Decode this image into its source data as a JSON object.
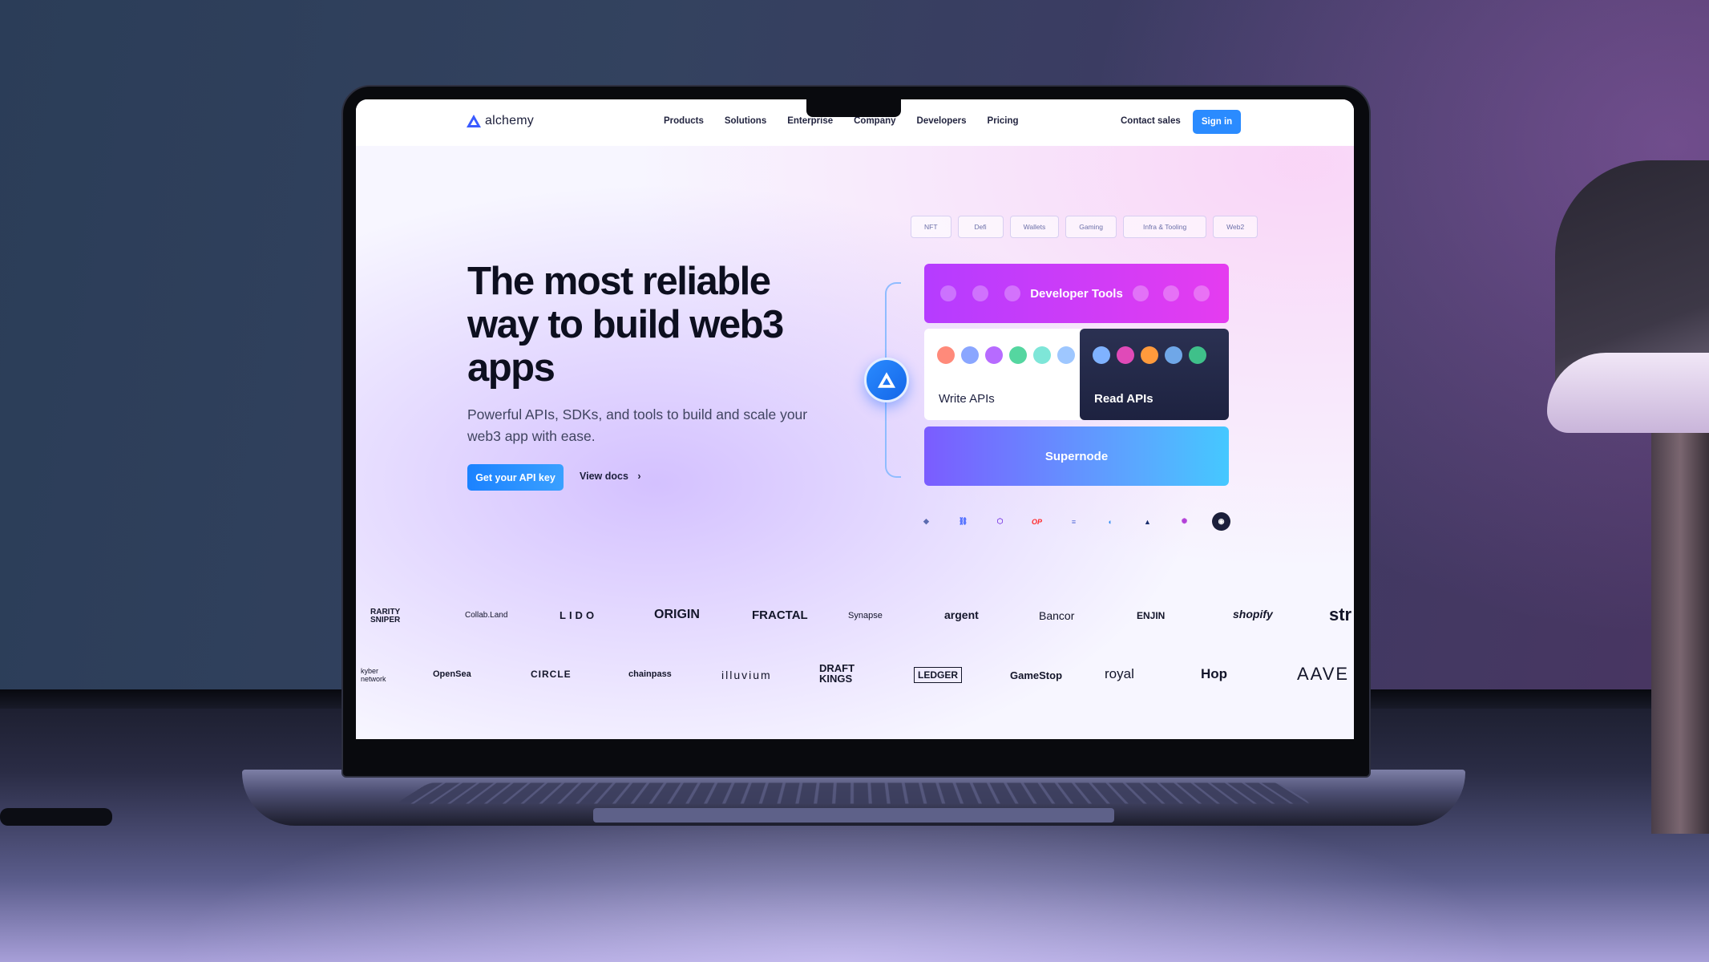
{
  "nav": {
    "brand": "alchemy",
    "menu": [
      "Products",
      "Solutions",
      "Enterprise",
      "Company",
      "Developers",
      "Pricing"
    ],
    "contact": "Contact sales",
    "signin": "Sign in"
  },
  "hero": {
    "title": "The most reliable way to build web3 apps",
    "subtitle": "Powerful APIs, SDKs, and tools to build and scale your web3 app with ease.",
    "cta": "Get your API key",
    "docs": "View docs",
    "docs_arrow": "›"
  },
  "product": {
    "tabs": [
      "NFT",
      "Defi",
      "Wallets",
      "Gaming",
      "Infra & Tooling",
      "Web2"
    ],
    "developer_tools": "Developer Tools",
    "write_apis": "Write APIs",
    "read_apis": "Read APIs",
    "supernode": "Supernode",
    "chains": [
      "ethereum",
      "chainlink",
      "polygon",
      "op",
      "solana",
      "arbitrum",
      "astar",
      "starknet",
      "flow"
    ],
    "chain_glyphs": [
      "◆",
      "⛓",
      "⬡",
      "OP",
      "≡",
      "◐",
      "▲",
      "✺",
      "◉"
    ]
  },
  "partners": {
    "row1": [
      "RARITY SNIPER",
      "Collab.Land",
      "LIDO",
      "ORIGIN",
      "FRACTAL",
      "Synapse",
      "argent",
      "Bancor",
      "ENJIN",
      "shopify",
      "str"
    ],
    "row2": [
      "kyber network",
      "OpenSea",
      "CIRCLE",
      "chainpass",
      "illuvium",
      "DRAFT KINGS",
      "LEDGER",
      "GameStop",
      "royal",
      "Hop",
      "AAVE"
    ]
  },
  "colors": {
    "accent": "#2a8bff",
    "developer_tools": "#c13cff",
    "read_apis": "#232946",
    "supernode": "#5a9dff"
  }
}
